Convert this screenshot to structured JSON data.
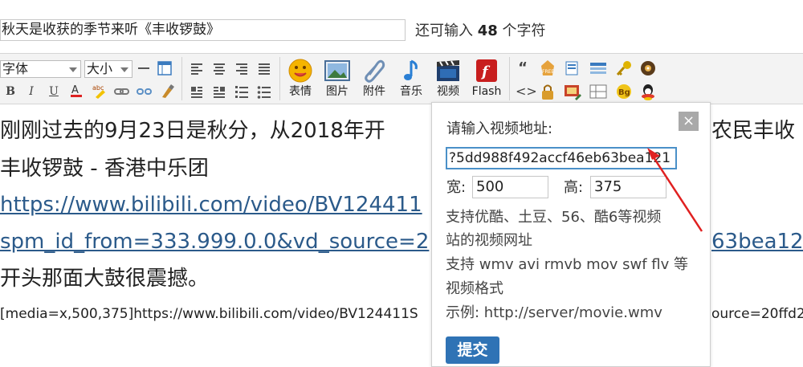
{
  "subject": {
    "value": "秋天是收获的季节来听《丰收锣鼓》"
  },
  "remaining": {
    "prefix": "还可输入",
    "count": "48",
    "suffix": "个字符"
  },
  "toolbar": {
    "font_select": "字体",
    "size_select": "大小",
    "buttons": [
      {
        "label": "表情",
        "icon": "smiley-icon"
      },
      {
        "label": "图片",
        "icon": "image-icon"
      },
      {
        "label": "附件",
        "icon": "paperclip-icon"
      },
      {
        "label": "音乐",
        "icon": "music-note-icon"
      },
      {
        "label": "视频",
        "icon": "video-icon"
      },
      {
        "label": "Flash",
        "icon": "flash-icon"
      }
    ]
  },
  "content": {
    "line1": "刚刚过去的9月23日是秋分，从2018年开",
    "line1_right": "农民丰收",
    "line2": "丰收锣鼓 - 香港中乐团",
    "link1": "https://www.bilibili.com/video/BV124411",
    "link2_left": "spm_id_from=333.999.0.0&vd_source=2",
    "link2_right": "63bea12",
    "line5": "开头那面大鼓很震撼。",
    "bbcode_left": "[media=x,500,375]https://www.bilibili.com/video/BV124411S",
    "bbcode_right": "ource=20ffd2"
  },
  "popup": {
    "close": "×",
    "title": "请输入视频地址:",
    "url_value": "?5dd988f492accf46eb63bea121",
    "width_label": "宽:",
    "width_value": "500",
    "height_label": "高:",
    "height_value": "375",
    "help1": "支持优酷、土豆、56、酷6等视频",
    "help2": "站的视频网址",
    "help3": "支持 wmv avi rmvb mov swf flv 等",
    "help4": "视频格式",
    "help5": "示例: http://server/movie.wmv",
    "submit": "提交"
  },
  "colors": {
    "accent": "#2f73b5",
    "annotation_arrow": "#e02020",
    "link": "#2b5a8a"
  }
}
